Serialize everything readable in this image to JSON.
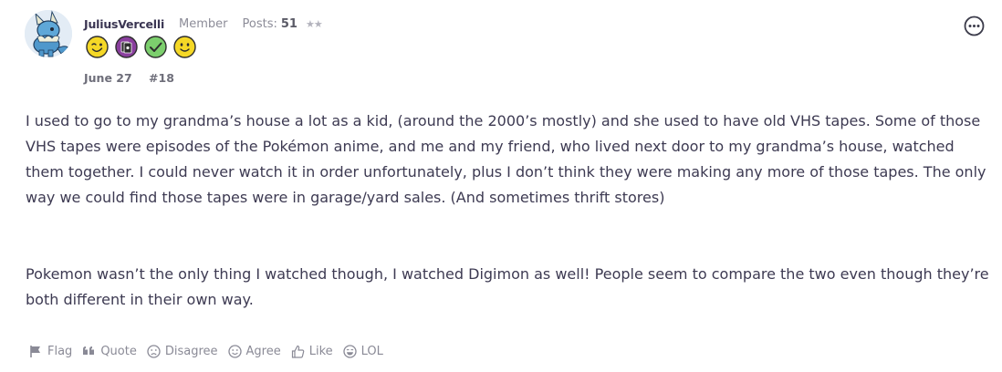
{
  "post": {
    "username": "JuliusVercelli",
    "role": "Member",
    "posts_label": "Posts:",
    "posts_count": "51",
    "stars": "★★",
    "date": "June 27",
    "post_number": "#18",
    "body_paragraphs": [
      "I used to go to my grandma’s house a lot as a kid, (around the 2000’s mostly) and she used to have old VHS tapes. Some of those VHS tapes were episodes of the Pokémon anime, and me and my friend, who lived next door to my grandma’s house, watched them together. I could never watch it in order unfortunately, plus I don’t think they were making any more of those tapes. The only way we could find those tapes were in garage/yard sales. (And sometimes thrift stores)",
      "Pokemon wasn’t the only thing I watched though, I watched Digimon as well! People seem to compare the two even though they’re both different in their own way."
    ]
  },
  "badges": [
    {
      "icon": "winking-face-icon",
      "color": "#f5d826"
    },
    {
      "icon": "cards-icon",
      "color": "#8a3f9e"
    },
    {
      "icon": "check-icon",
      "color": "#7ccf6d"
    },
    {
      "icon": "smiling-face-icon",
      "color": "#f5d826"
    }
  ],
  "actions": {
    "flag": "Flag",
    "quote": "Quote",
    "disagree": "Disagree",
    "agree": "Agree",
    "like": "Like",
    "lol": "LOL"
  },
  "colors": {
    "text": "#3d3a52",
    "muted": "#8a8a96",
    "username": "#3a3552"
  }
}
